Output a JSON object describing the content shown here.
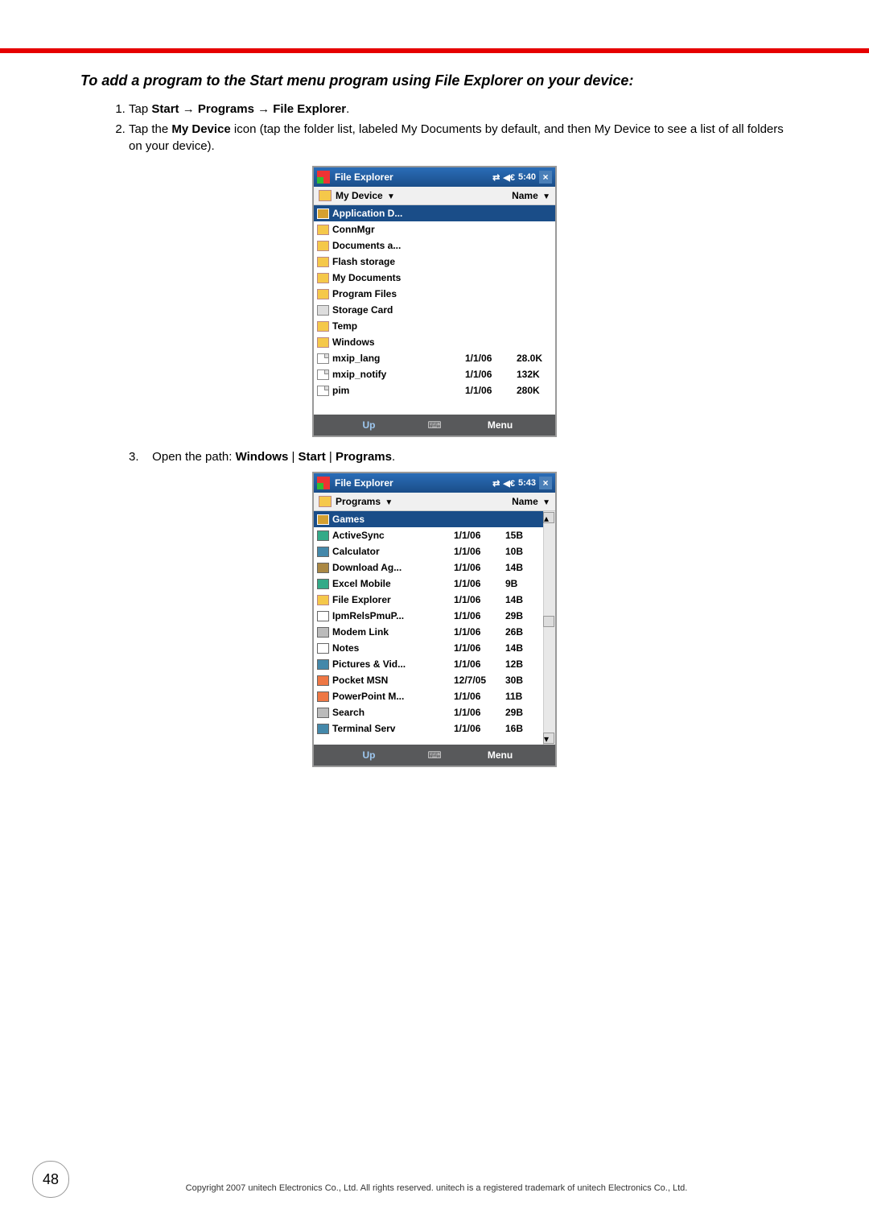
{
  "heading": "To add a program to the Start menu program using File Explorer on your device:",
  "steps": [
    {
      "n": "1.",
      "pre": "Tap ",
      "bold": [
        "Start",
        "Programs",
        "File Explorer"
      ],
      "sep": " → ",
      "post": "."
    },
    {
      "n": "2.",
      "pre": "Tap the ",
      "bold": [
        "My Device"
      ],
      "post": " icon (tap the folder list, labeled My Documents by default, and then My Device to see a list of all folders on your device)."
    }
  ],
  "step3": {
    "n": "3.",
    "pre": "Open the path: ",
    "bold": [
      "Windows",
      "Start",
      "Programs"
    ],
    "sep": " | ",
    "post": "."
  },
  "shot1": {
    "title": "File Explorer",
    "time": "5:40",
    "location": "My Device",
    "sort": "Name",
    "rows": [
      {
        "sel": true,
        "ico": "folder-sel",
        "name": "Application D...",
        "date": "",
        "size": ""
      },
      {
        "ico": "folder",
        "name": "ConnMgr",
        "date": "",
        "size": ""
      },
      {
        "ico": "folder",
        "name": "Documents a...",
        "date": "",
        "size": ""
      },
      {
        "ico": "folder",
        "name": "Flash storage",
        "date": "",
        "size": ""
      },
      {
        "ico": "folder",
        "name": "My Documents",
        "date": "",
        "size": ""
      },
      {
        "ico": "folder",
        "name": "Program Files",
        "date": "",
        "size": ""
      },
      {
        "ico": "card",
        "name": "Storage Card",
        "date": "",
        "size": ""
      },
      {
        "ico": "folder",
        "name": "Temp",
        "date": "",
        "size": ""
      },
      {
        "ico": "folder",
        "name": "Windows",
        "date": "",
        "size": ""
      },
      {
        "ico": "file",
        "name": "mxip_lang",
        "date": "1/1/06",
        "size": "28.0K"
      },
      {
        "ico": "file",
        "name": "mxip_notify",
        "date": "1/1/06",
        "size": "132K"
      },
      {
        "ico": "file",
        "name": "pim",
        "date": "1/1/06",
        "size": "280K"
      }
    ],
    "up": "Up",
    "menu": "Menu"
  },
  "shot2": {
    "title": "File Explorer",
    "time": "5:43",
    "location": "Programs",
    "sort": "Name",
    "rows": [
      {
        "sel": true,
        "ico": "folder-sel",
        "name": "Games",
        "date": "",
        "size": ""
      },
      {
        "ico": "app",
        "name": "ActiveSync",
        "date": "1/1/06",
        "size": "15B"
      },
      {
        "ico": "app2",
        "name": "Calculator",
        "date": "1/1/06",
        "size": "10B"
      },
      {
        "ico": "app3",
        "name": "Download Ag...",
        "date": "1/1/06",
        "size": "14B"
      },
      {
        "ico": "app",
        "name": "Excel Mobile",
        "date": "1/1/06",
        "size": "9B"
      },
      {
        "ico": "folder",
        "name": "File Explorer",
        "date": "1/1/06",
        "size": "14B"
      },
      {
        "ico": "app5",
        "name": "IpmRelsPmuP...",
        "date": "1/1/06",
        "size": "29B"
      },
      {
        "ico": "app6",
        "name": "Modem Link",
        "date": "1/1/06",
        "size": "26B"
      },
      {
        "ico": "app5",
        "name": "Notes",
        "date": "1/1/06",
        "size": "14B"
      },
      {
        "ico": "app2",
        "name": "Pictures & Vid...",
        "date": "1/1/06",
        "size": "12B"
      },
      {
        "ico": "app4",
        "name": "Pocket MSN",
        "date": "12/7/05",
        "size": "30B"
      },
      {
        "ico": "app4",
        "name": "PowerPoint M...",
        "date": "1/1/06",
        "size": "11B"
      },
      {
        "ico": "app6",
        "name": "Search",
        "date": "1/1/06",
        "size": "29B"
      },
      {
        "ico": "app2",
        "name": "Terminal Serv",
        "date": "1/1/06",
        "size": "16B"
      }
    ],
    "up": "Up",
    "menu": "Menu"
  },
  "pageNumber": "48",
  "footer": "Copyright 2007 unitech Electronics Co., Ltd. All rights reserved. unitech is a registered trademark of unitech Electronics Co., Ltd."
}
